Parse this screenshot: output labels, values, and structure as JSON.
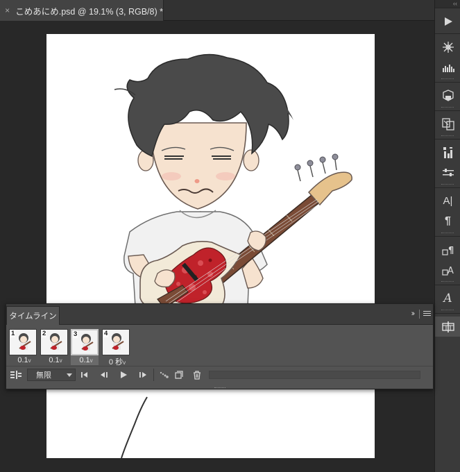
{
  "document_tab": {
    "close_glyph": "×",
    "title": "こめあにめ.psd @ 19.1% (3, RGB/8) *"
  },
  "dock": {
    "top_collapse": "‹‹",
    "buttons": [
      {
        "name": "play-icon"
      },
      {
        "name": "brush-settings-icon"
      },
      {
        "name": "histogram-icon"
      },
      {
        "name": "3d-icon"
      },
      {
        "name": "clone-source-icon"
      },
      {
        "name": "adjustments-icon"
      },
      {
        "name": "properties-icon"
      },
      {
        "name": "character-icon",
        "label": "A|"
      },
      {
        "name": "paragraph-icon",
        "label": "¶"
      },
      {
        "name": "paragraph-styles-icon"
      },
      {
        "name": "character-styles-icon"
      },
      {
        "name": "glyphs-icon",
        "label": "A"
      },
      {
        "name": "timeline-icon"
      }
    ]
  },
  "timeline": {
    "tab_label": "タイムライン",
    "collapse_glyph": "››",
    "frames": [
      {
        "number": "1",
        "delay": "0.1",
        "selected": false
      },
      {
        "number": "2",
        "delay": "0.1",
        "selected": false
      },
      {
        "number": "3",
        "delay": "0.1",
        "selected": true
      },
      {
        "number": "4",
        "delay": "0 秒",
        "selected": false
      }
    ],
    "delay_chevron": "v",
    "loop_option": "無限"
  },
  "colors": {
    "panel_bg": "#535353",
    "canvas_bg": "#ffffff",
    "app_bg": "#282828",
    "guitar_body": "#c0222a",
    "hair": "#4a4a4a"
  }
}
